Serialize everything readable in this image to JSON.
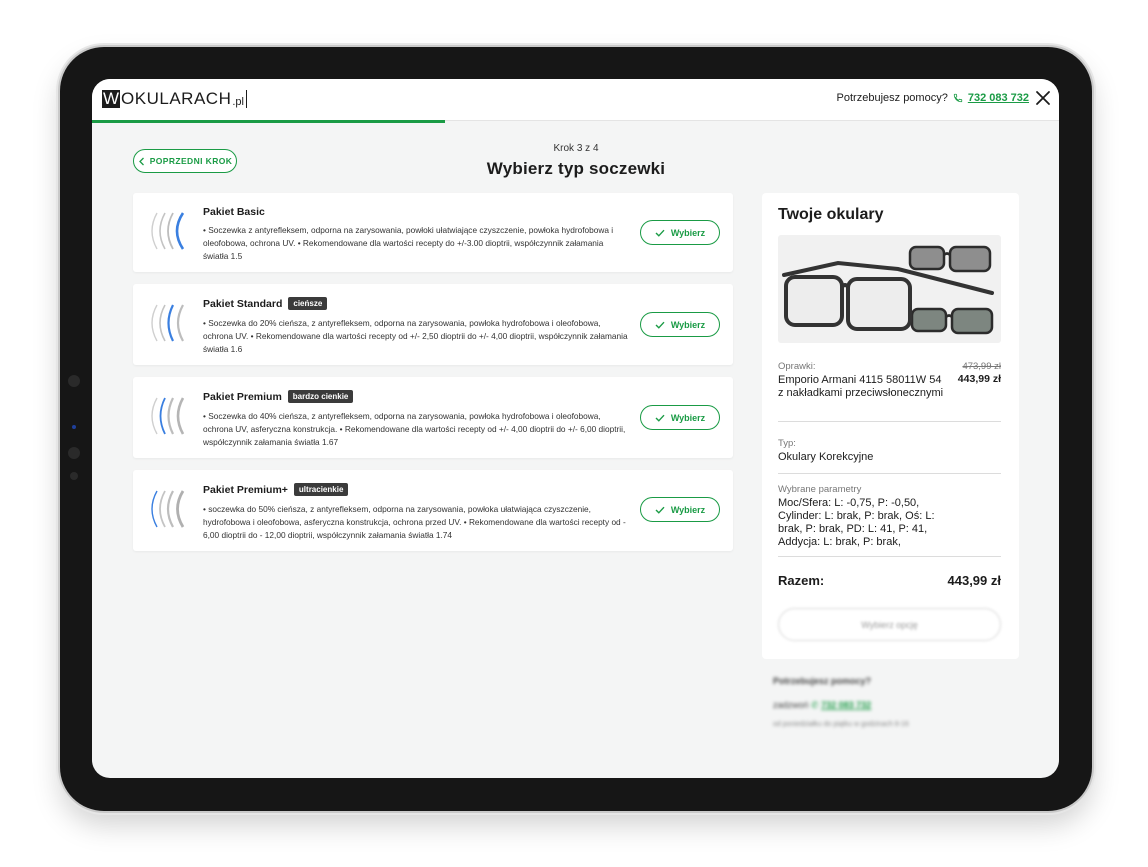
{
  "header": {
    "logo": {
      "w": "W",
      "text": "OKULARACH",
      "suffix": ".pl"
    },
    "help_text": "Potrzebujesz pomocy?",
    "help_phone": "732 083 732",
    "close_icon": "close-icon",
    "phone_icon": "phone-icon"
  },
  "progress": {
    "value": 0.365
  },
  "step": {
    "back_label": "POPRZEDNI KROK",
    "step_label": "Krok 3 z 4",
    "title": "Wybierz typ soczewki"
  },
  "packages": [
    {
      "name": "Pakiet Basic",
      "badge": "",
      "description": "• Soczewka z antyrefleksem, odporna na zarysowania, powłoki ułatwiające czyszczenie, powłoka hydrofobowa i oleofobowa, ochrona UV. • Rekomendowane dla wartości recepty do +/-3.00 dioptrii, współczynnik załamania światła 1.5",
      "button_label": "Wybierz"
    },
    {
      "name": "Pakiet Standard",
      "badge": "cieńsze",
      "description": "• Soczewka do 20% cieńsza, z antyrefleksem, odporna na zarysowania, powłoka hydrofobowa i oleofobowa, ochrona UV. • Rekomendowane dla wartości recepty od +/- 2,50 dioptrii do +/- 4,00 dioptrii, współczynnik załamania światła 1.6",
      "button_label": "Wybierz"
    },
    {
      "name": "Pakiet Premium",
      "badge": "bardzo cienkie",
      "description": "• Soczewka do 40% cieńsza, z antyrefleksem, odporna na zarysowania, powłoka hydrofobowa i oleofobowa, ochrona UV, asferyczna konstrukcja. • Rekomendowane dla wartości recepty od +/- 4,00 dioptrii do +/- 6,00 dioptrii, współczynnik załamania światła 1.67",
      "button_label": "Wybierz"
    },
    {
      "name": "Pakiet Premium+",
      "badge": "ultracienkie",
      "description": "• soczewka do 50% cieńsza, z antyrefleksem, odporna na zarysowania, powłoka ułatwiająca czyszczenie, hydrofobowa i oleofobowa, asferyczna konstrukcja, ochrona przed UV. • Rekomendowane dla wartości recepty od - 6,00 dioptrii do - 12,00 dioptrii, współczynnik załamania światła 1.74",
      "button_label": "Wybierz"
    }
  ],
  "summary": {
    "title": "Twoje okulary",
    "frame_label": "Oprawki:",
    "frame_name": "Emporio Armani 4115 58011W 54 z nakładkami przeciwsłonecznymi",
    "old_price": "473,99 zł",
    "new_price": "443,99 zł",
    "type_label": "Typ:",
    "type_value": "Okulary Korekcyjne",
    "params_label": "Wybrane parametry",
    "params_value": "Moc/Sfera: L: -0,75, P: -0,50, Cylinder: L: brak, P: brak, Oś: L: brak, P: brak, PD: L: 41, P: 41, Addycja: L: brak, P: brak,",
    "total_label": "Razem:",
    "total_value": "443,99 zł",
    "select_button": "Wybierz opcję"
  },
  "help_block": {
    "title": "Potrzebujesz pomocy?",
    "call_label": "zadzwoń",
    "phone": "732 083 732",
    "note": "od poniedziałku do piątku w godzinach 8-16"
  },
  "colors": {
    "accent": "#1a9b45",
    "lens_blue": "#3a7fe0",
    "badge_bg": "#3b3b3b",
    "frame": "#161616",
    "screen_bg": "#f4f5f5"
  }
}
